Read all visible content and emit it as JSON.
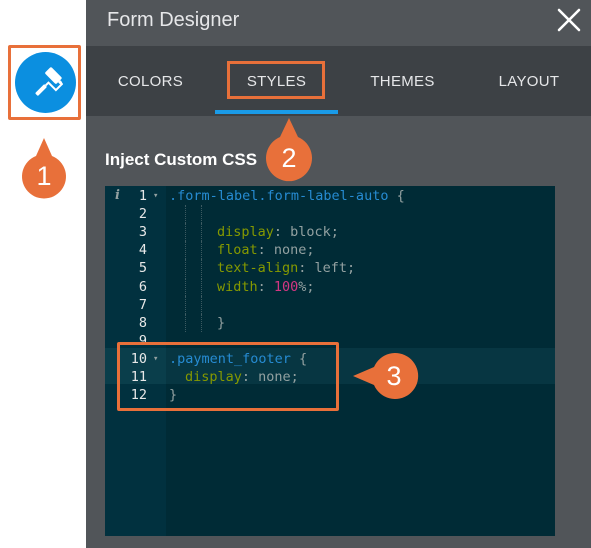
{
  "panel": {
    "title": "Form Designer",
    "tabs": [
      {
        "label": "COLORS"
      },
      {
        "label": "STYLES"
      },
      {
        "label": "THEMES"
      },
      {
        "label": "LAYOUT"
      }
    ],
    "active_tab": "STYLES",
    "section_title": "Inject Custom CSS"
  },
  "callouts": [
    "1",
    "2",
    "3"
  ],
  "editor": {
    "lines": [
      {
        "n": "1",
        "fold": true,
        "code": ".form-label.form-label-auto {"
      },
      {
        "n": "2",
        "code": ""
      },
      {
        "n": "3",
        "prop": "display",
        "value": "block;"
      },
      {
        "n": "4",
        "prop": "float",
        "value": "none;"
      },
      {
        "n": "5",
        "prop": "text-align",
        "value": "left;"
      },
      {
        "n": "6",
        "prop": "width",
        "num": "100",
        "value": "%;"
      },
      {
        "n": "7",
        "code": ""
      },
      {
        "n": "8",
        "code": "}"
      },
      {
        "n": "9",
        "code": ""
      },
      {
        "n": "10",
        "fold": true,
        "code": ".payment_footer {"
      },
      {
        "n": "11",
        "prop": "display",
        "value": "none;"
      },
      {
        "n": "12",
        "code": "}"
      }
    ]
  },
  "colors": {
    "accent_blue": "#0b8fe0",
    "callout_orange": "#e8703a",
    "panel_bg": "#515559",
    "tabs_bg": "#3d4145",
    "editor_bg": "#002b36"
  },
  "icons": [
    "paint-roller-icon",
    "close-icon",
    "info-icon",
    "fold-arrow-icon"
  ]
}
